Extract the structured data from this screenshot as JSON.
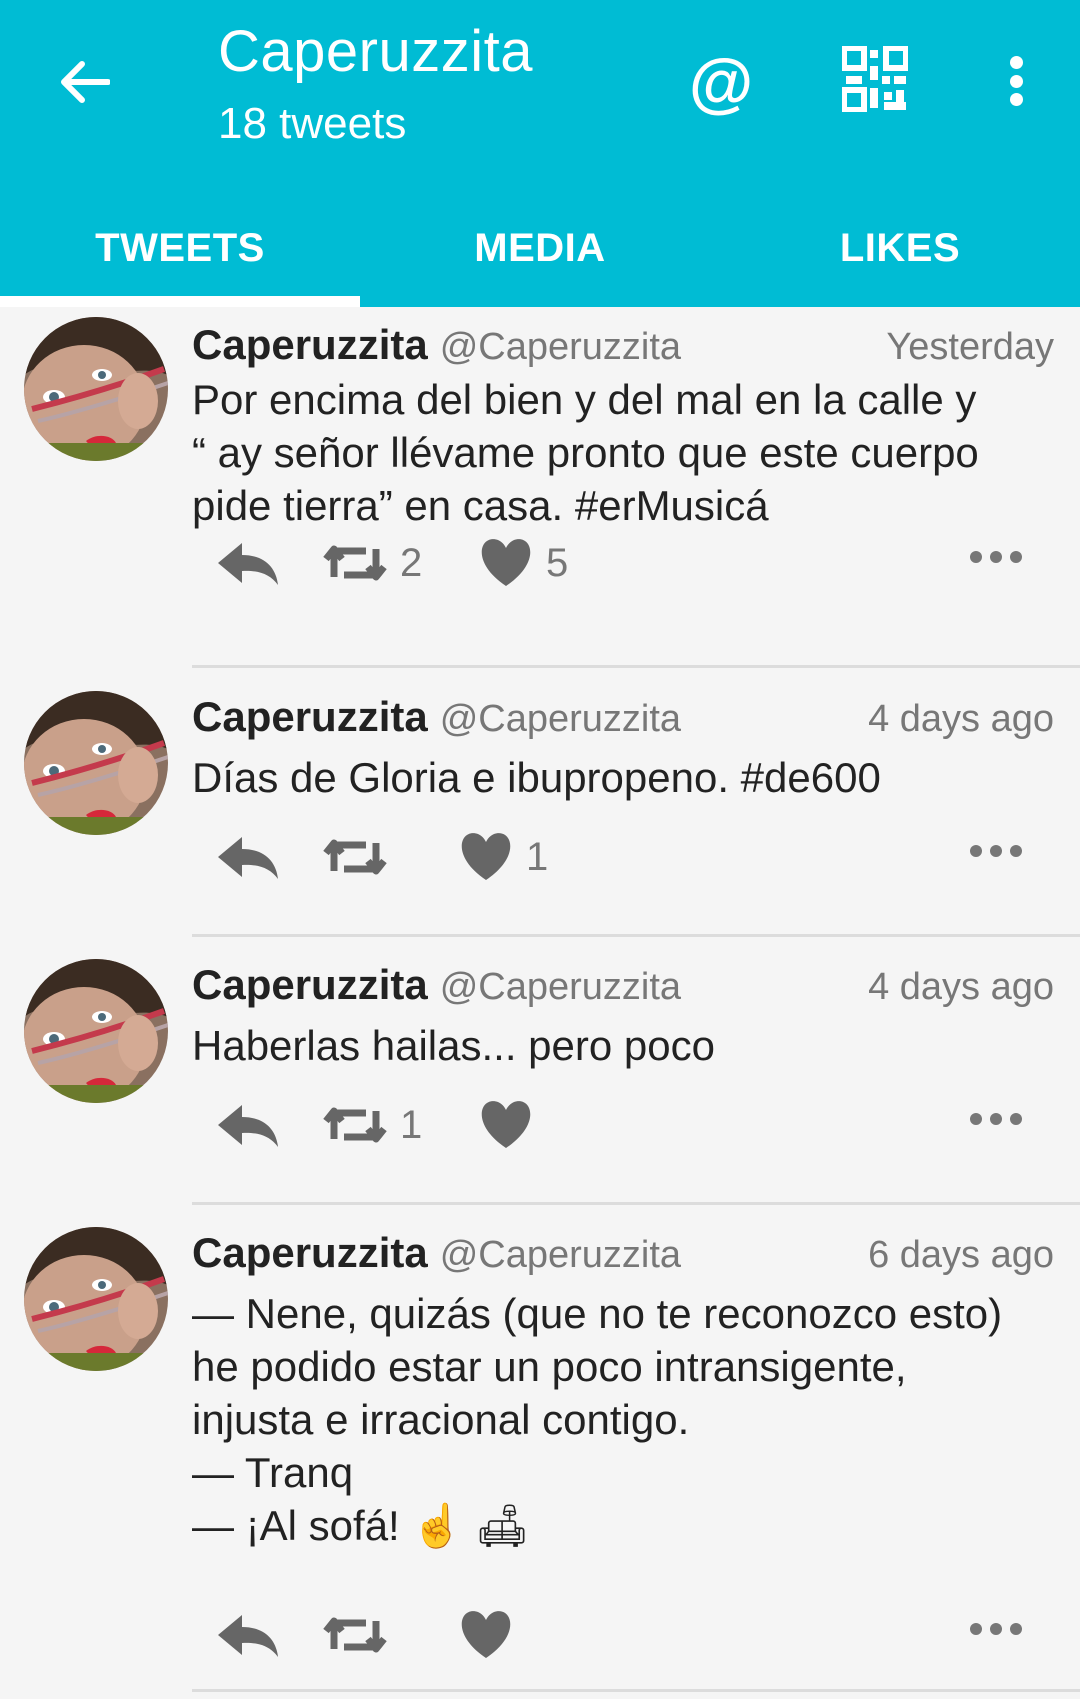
{
  "header": {
    "title": "Caperuzzita",
    "subtitle": "18 tweets",
    "mention_icon": "@",
    "icons": [
      "back-arrow-icon",
      "mention-icon",
      "qr-code-icon",
      "more-vert-icon"
    ]
  },
  "tabs": [
    {
      "label": "TWEETS",
      "active": true
    },
    {
      "label": "MEDIA",
      "active": false
    },
    {
      "label": "LIKES",
      "active": false
    }
  ],
  "colors": {
    "accent": "#00bcd4",
    "background": "#f5f5f5",
    "text_primary": "#222222",
    "text_secondary": "#777777"
  },
  "tweets": [
    {
      "name": "Caperuzzita",
      "handle": "@Caperuzzita",
      "time": "Yesterday",
      "text": "Por encima del bien y del mal en la calle y\n“ ay señor llévame pronto que este cuerpo\npide tierra” en casa. #erMusicá",
      "retweets": "2",
      "likes": "5"
    },
    {
      "name": "Caperuzzita",
      "handle": "@Caperuzzita",
      "time": "4 days ago",
      "text": "Días de Gloria e ibupropeno. #de600",
      "retweets": "",
      "likes": "1"
    },
    {
      "name": "Caperuzzita",
      "handle": "@Caperuzzita",
      "time": "4 days ago",
      "text": "Haberlas hailas... pero poco",
      "retweets": "1",
      "likes": ""
    },
    {
      "name": "Caperuzzita",
      "handle": "@Caperuzzita",
      "time": "6 days ago",
      "text": "— Nene, quizás (que no te reconozco esto)\nhe podido estar  un poco intransigente,\ninjusta e irracional contigo.\n— Tranq\n— ¡Al sofá! ☝️ 🛋",
      "retweets": "",
      "likes": ""
    }
  ]
}
